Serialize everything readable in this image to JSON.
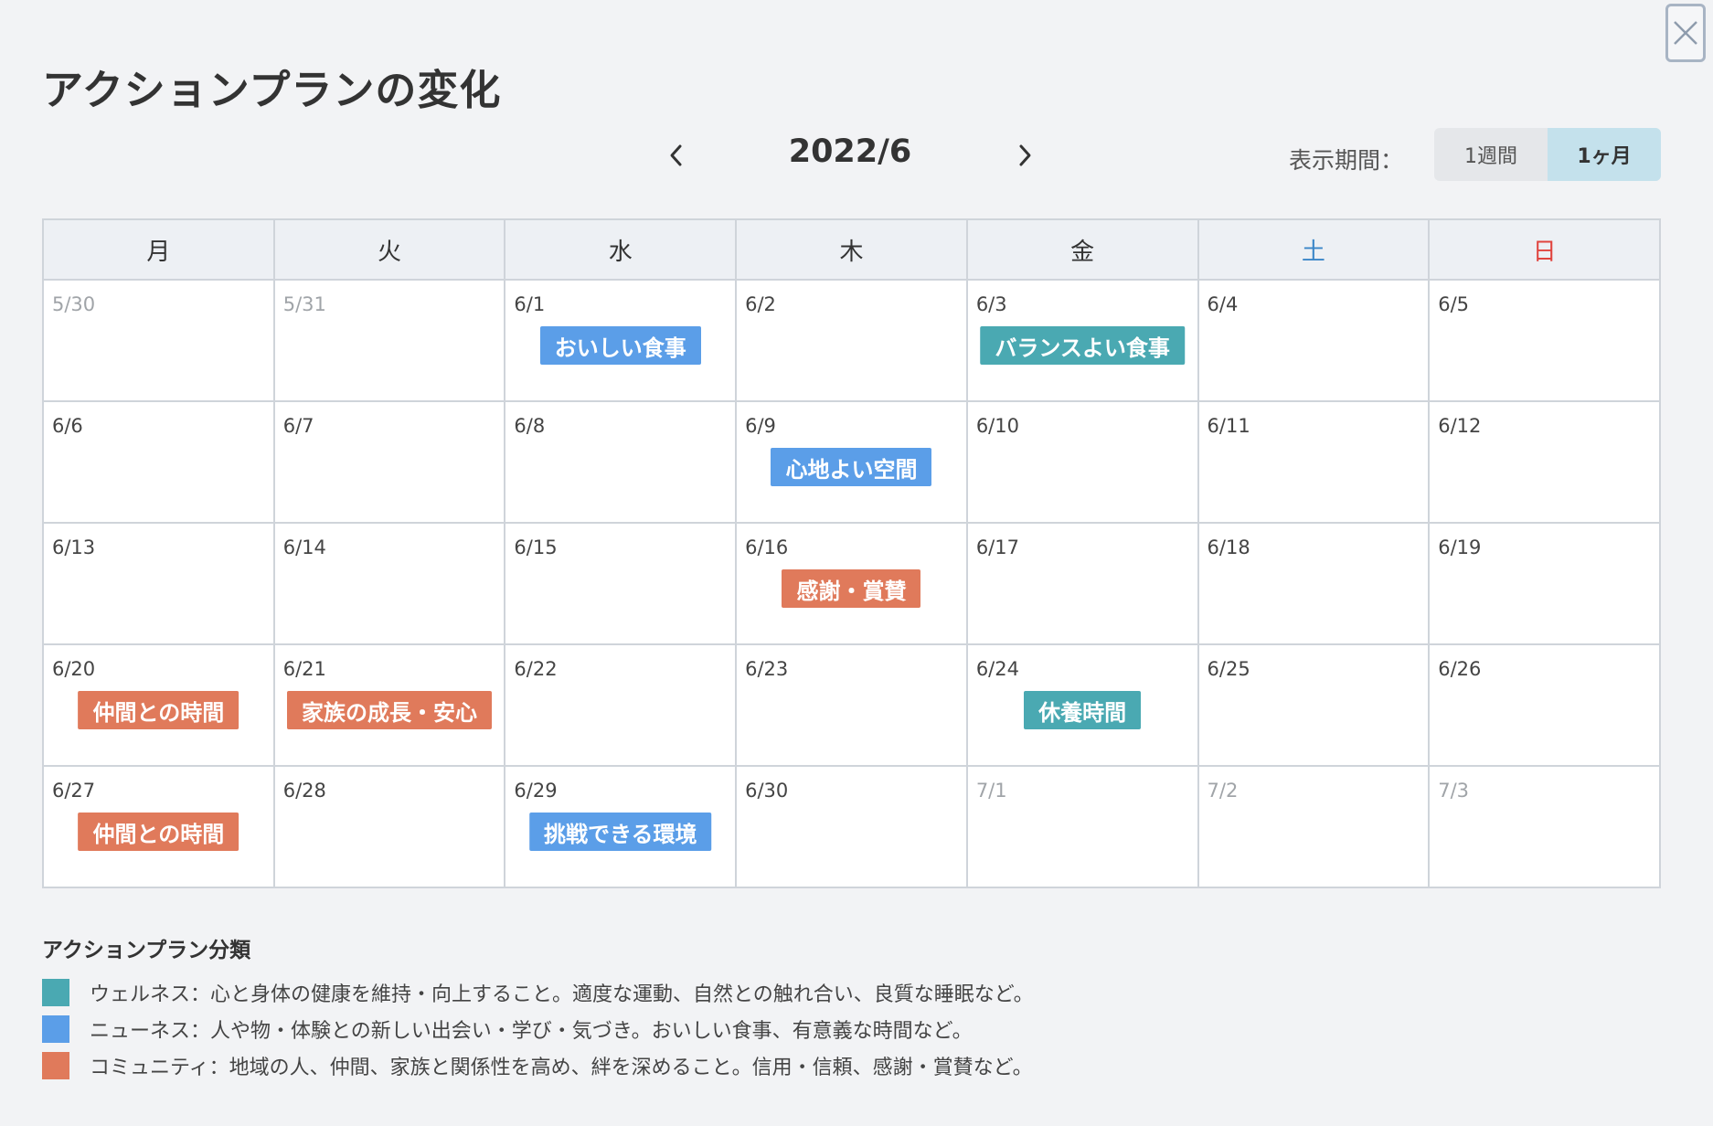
{
  "window": {
    "title": "アクションプランの変化"
  },
  "colors": {
    "wellness": "#4aa9b2",
    "newness": "#5b9ee8",
    "community": "#e07a5b",
    "saturday": "#3a86c8",
    "sunday": "#e0443e"
  },
  "icons": {
    "close": "close-icon",
    "prev": "chevron-left-icon",
    "next": "chevron-right-icon"
  },
  "nav": {
    "month": "2022/6"
  },
  "period": {
    "label": "表示期間：",
    "options": [
      "1週間",
      "1ヶ月"
    ],
    "selected": "1ヶ月"
  },
  "calendar": {
    "weekdays": [
      "月",
      "火",
      "水",
      "木",
      "金",
      "土",
      "日"
    ],
    "weeks": [
      [
        {
          "date": "5/30",
          "other": true
        },
        {
          "date": "5/31",
          "other": true
        },
        {
          "date": "6/1",
          "tag": {
            "label": "おいしい食事",
            "type": "newness"
          }
        },
        {
          "date": "6/2"
        },
        {
          "date": "6/3",
          "tag": {
            "label": "バランスよい食事",
            "type": "wellness"
          }
        },
        {
          "date": "6/4"
        },
        {
          "date": "6/5"
        }
      ],
      [
        {
          "date": "6/6"
        },
        {
          "date": "6/7"
        },
        {
          "date": "6/8"
        },
        {
          "date": "6/9",
          "tag": {
            "label": "心地よい空間",
            "type": "newness"
          }
        },
        {
          "date": "6/10"
        },
        {
          "date": "6/11"
        },
        {
          "date": "6/12"
        }
      ],
      [
        {
          "date": "6/13"
        },
        {
          "date": "6/14"
        },
        {
          "date": "6/15"
        },
        {
          "date": "6/16",
          "tag": {
            "label": "感謝・賞賛",
            "type": "community"
          }
        },
        {
          "date": "6/17"
        },
        {
          "date": "6/18"
        },
        {
          "date": "6/19"
        }
      ],
      [
        {
          "date": "6/20",
          "tag": {
            "label": "仲間との時間",
            "type": "community"
          }
        },
        {
          "date": "6/21",
          "tag": {
            "label": "家族の成長・安心",
            "type": "community"
          }
        },
        {
          "date": "6/22"
        },
        {
          "date": "6/23"
        },
        {
          "date": "6/24",
          "tag": {
            "label": "休養時間",
            "type": "wellness"
          }
        },
        {
          "date": "6/25"
        },
        {
          "date": "6/26"
        }
      ],
      [
        {
          "date": "6/27",
          "tag": {
            "label": "仲間との時間",
            "type": "community"
          }
        },
        {
          "date": "6/28"
        },
        {
          "date": "6/29",
          "tag": {
            "label": "挑戦できる環境",
            "type": "newness"
          }
        },
        {
          "date": "6/30"
        },
        {
          "date": "7/1",
          "other": true
        },
        {
          "date": "7/2",
          "other": true
        },
        {
          "date": "7/3",
          "other": true
        }
      ]
    ]
  },
  "legend": {
    "title": "アクションプラン分類",
    "items": [
      {
        "type": "wellness",
        "text": "ウェルネス：心と身体の健康を維持・向上すること。適度な運動、自然との触れ合い、良質な睡眠など。"
      },
      {
        "type": "newness",
        "text": "ニューネス：人や物・体験との新しい出会い・学び・気づき。おいしい食事、有意義な時間など。"
      },
      {
        "type": "community",
        "text": "コミュニティ：地域の人、仲間、家族と関係性を高め、絆を深めること。信用・信頼、感謝・賞賛など。"
      }
    ]
  }
}
